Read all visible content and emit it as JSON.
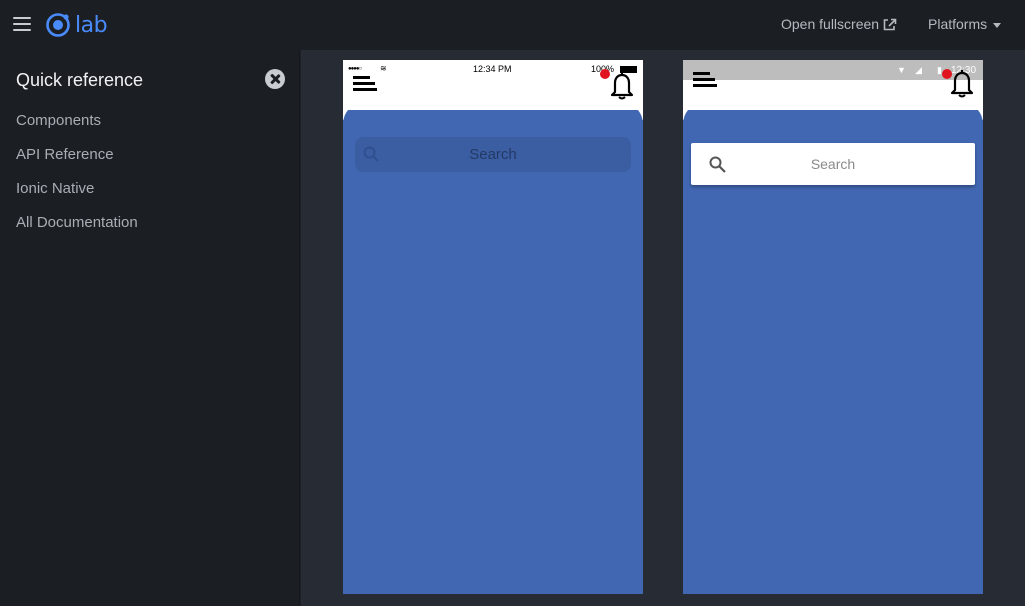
{
  "header": {
    "logo_text": "lab",
    "open_fullscreen": "Open fullscreen",
    "platforms": "Platforms"
  },
  "sidebar": {
    "title": "Quick reference",
    "links": [
      {
        "label": "Components"
      },
      {
        "label": "API Reference"
      },
      {
        "label": "Ionic Native"
      },
      {
        "label": "All Documentation"
      }
    ]
  },
  "ios_preview": {
    "status_time": "12:34 PM",
    "battery": "100%",
    "search_placeholder": "Search"
  },
  "md_preview": {
    "status_time": "12:30",
    "search_placeholder": "Search"
  },
  "colors": {
    "accent": "#4a8bfc",
    "app_bg": "#4267b2",
    "notification_dot": "#e0141e"
  }
}
